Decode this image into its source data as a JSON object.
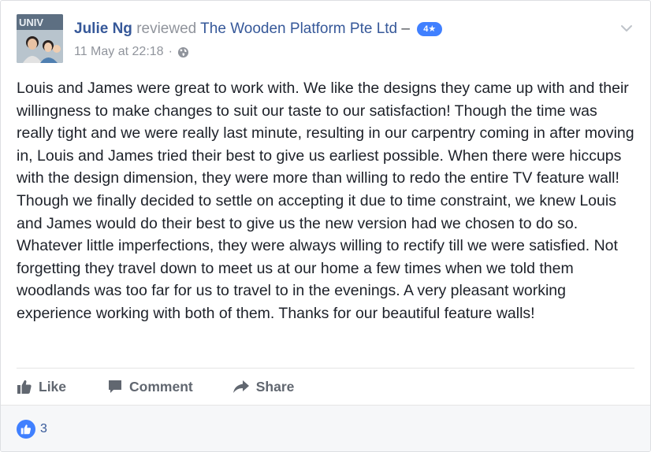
{
  "post": {
    "author": "Julie Ng",
    "verb": "reviewed",
    "page": "The Wooden Platform Pte Ltd",
    "dash": "–",
    "rating": "4★",
    "date": "11 May at 22:18",
    "separator": "·",
    "avatar_caption": "UNIV",
    "privacy_icon": "globe-icon",
    "menu_icon": "chevron-down-icon",
    "text": "Louis and James were great to work with. We like the designs they came up with and their willingness to make changes to suit our taste to our satisfaction! Though the time was really tight and we were really last minute, resulting in our carpentry coming in after moving in, Louis and James tried their best to give us earliest possible. When there were hiccups with the design dimension, they were more than willing to redo the entire TV feature wall! Though we finally decided to settle on accepting it due to time constraint, we knew Louis and James would do their best to give us the new version had we chosen to do so. Whatever little imperfections, they were always willing to rectify till we were satisfied. Not forgetting they travel down to meet us at our home a few times when we told them woodlands was too far for us to travel to in the evenings. A very pleasant working experience working with both of them. Thanks for our beautiful feature walls!"
  },
  "actions": {
    "like_label": "Like",
    "comment_label": "Comment",
    "share_label": "Share"
  },
  "reactions": {
    "count": "3",
    "icon": "thumbs-up-icon"
  },
  "colors": {
    "link_blue": "#365899",
    "badge_blue": "#4080ff",
    "meta_gray": "#90949c",
    "action_gray": "#616770"
  }
}
